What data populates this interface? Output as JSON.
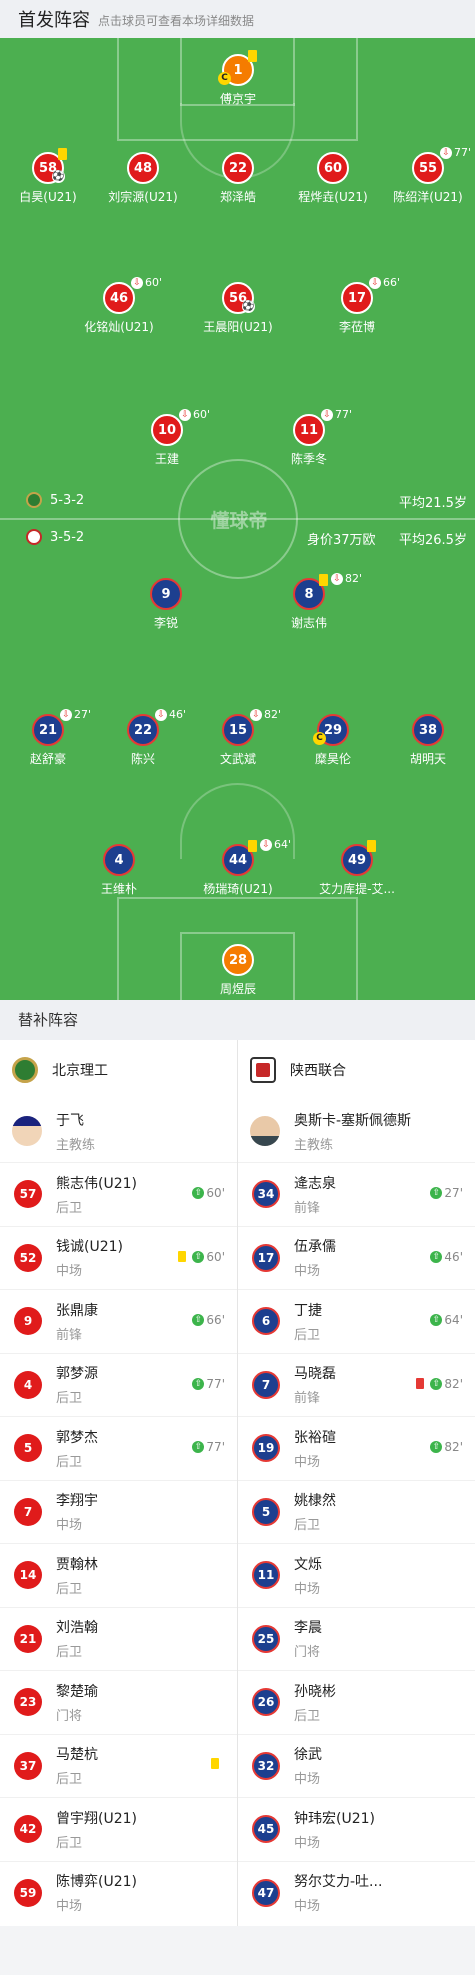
{
  "header": {
    "title": "首发阵容",
    "subtitle": "点击球员可查看本场详细数据"
  },
  "watermark": "懂球帝",
  "home": {
    "formation": "5-3-2",
    "avg_age": "平均21.5岁",
    "name": "北京理工",
    "color": "#e01b1b"
  },
  "away": {
    "formation": "3-5-2",
    "value": "身价37万欧",
    "avg_age": "平均26.5岁",
    "name": "陕西联合",
    "color": "#1d3f8f"
  },
  "home_lineup": [
    {
      "num": "1",
      "name": "傅京宇",
      "gk": true,
      "captain": true,
      "yellow": true
    },
    {
      "num": "58",
      "name": "白昊(U21)",
      "yellow": true,
      "goal": true
    },
    {
      "num": "48",
      "name": "刘宗源(U21)"
    },
    {
      "num": "22",
      "name": "郑泽皓"
    },
    {
      "num": "60",
      "name": "程烨垚(U21)"
    },
    {
      "num": "55",
      "name": "陈绍洋(U21)",
      "sub": "77'"
    },
    {
      "num": "46",
      "name": "化铭灿(U21)",
      "sub": "60'"
    },
    {
      "num": "56",
      "name": "王晨阳(U21)",
      "goal": true
    },
    {
      "num": "17",
      "name": "李莅博",
      "sub": "66'"
    },
    {
      "num": "10",
      "name": "王建",
      "sub": "60'"
    },
    {
      "num": "11",
      "name": "陈季冬",
      "sub": "77'"
    }
  ],
  "away_lineup": [
    {
      "num": "9",
      "name": "李锐"
    },
    {
      "num": "8",
      "name": "谢志伟",
      "yellow": true,
      "sub": "82'"
    },
    {
      "num": "21",
      "name": "赵舒豪",
      "sub": "27'"
    },
    {
      "num": "22",
      "name": "陈兴",
      "sub": "46'"
    },
    {
      "num": "15",
      "name": "文武斌",
      "sub": "82'"
    },
    {
      "num": "29",
      "name": "糜昊伦",
      "captain": true
    },
    {
      "num": "38",
      "name": "胡明天"
    },
    {
      "num": "4",
      "name": "王维朴"
    },
    {
      "num": "44",
      "name": "杨瑞琦(U21)",
      "yellow": true,
      "sub": "64'"
    },
    {
      "num": "49",
      "name": "艾力库提-艾...",
      "yellow": true
    },
    {
      "num": "28",
      "name": "周煜辰",
      "gk": true
    }
  ],
  "subs": {
    "title": "替补阵容",
    "home_coach": {
      "name": "于飞",
      "role": "主教练"
    },
    "away_coach": {
      "name": "奥斯卡-塞斯佩德斯",
      "role": "主教练"
    },
    "home": [
      {
        "num": "57",
        "name": "熊志伟(U21)",
        "pos": "后卫",
        "in": "60'"
      },
      {
        "num": "52",
        "name": "钱诚(U21)",
        "pos": "中场",
        "in": "60'",
        "card": "yellow"
      },
      {
        "num": "9",
        "name": "张鼎康",
        "pos": "前锋",
        "in": "66'"
      },
      {
        "num": "4",
        "name": "郭梦源",
        "pos": "后卫",
        "in": "77'"
      },
      {
        "num": "5",
        "name": "郭梦杰",
        "pos": "后卫",
        "in": "77'"
      },
      {
        "num": "7",
        "name": "李翔宇",
        "pos": "中场"
      },
      {
        "num": "14",
        "name": "贾翰林",
        "pos": "后卫"
      },
      {
        "num": "21",
        "name": "刘浩翰",
        "pos": "后卫"
      },
      {
        "num": "23",
        "name": "黎楚瑜",
        "pos": "门将"
      },
      {
        "num": "37",
        "name": "马楚杭",
        "pos": "后卫",
        "card": "yellow"
      },
      {
        "num": "42",
        "name": "曾宇翔(U21)",
        "pos": "后卫"
      },
      {
        "num": "59",
        "name": "陈博弈(U21)",
        "pos": "中场"
      }
    ],
    "away": [
      {
        "num": "34",
        "name": "逄志泉",
        "pos": "前锋",
        "in": "27'"
      },
      {
        "num": "17",
        "name": "伍承儒",
        "pos": "中场",
        "in": "46'"
      },
      {
        "num": "6",
        "name": "丁捷",
        "pos": "后卫",
        "in": "64'"
      },
      {
        "num": "7",
        "name": "马晓磊",
        "pos": "前锋",
        "in": "82'",
        "card": "red"
      },
      {
        "num": "19",
        "name": "张裕碹",
        "pos": "中场",
        "in": "82'"
      },
      {
        "num": "5",
        "name": "姚棣然",
        "pos": "后卫"
      },
      {
        "num": "11",
        "name": "文烁",
        "pos": "中场"
      },
      {
        "num": "25",
        "name": "李晨",
        "pos": "门将"
      },
      {
        "num": "26",
        "name": "孙晓彬",
        "pos": "后卫"
      },
      {
        "num": "32",
        "name": "徐武",
        "pos": "中场"
      },
      {
        "num": "45",
        "name": "钟玮宏(U21)",
        "pos": "中场"
      },
      {
        "num": "47",
        "name": "努尔艾力-吐...",
        "pos": "中场"
      }
    ]
  }
}
